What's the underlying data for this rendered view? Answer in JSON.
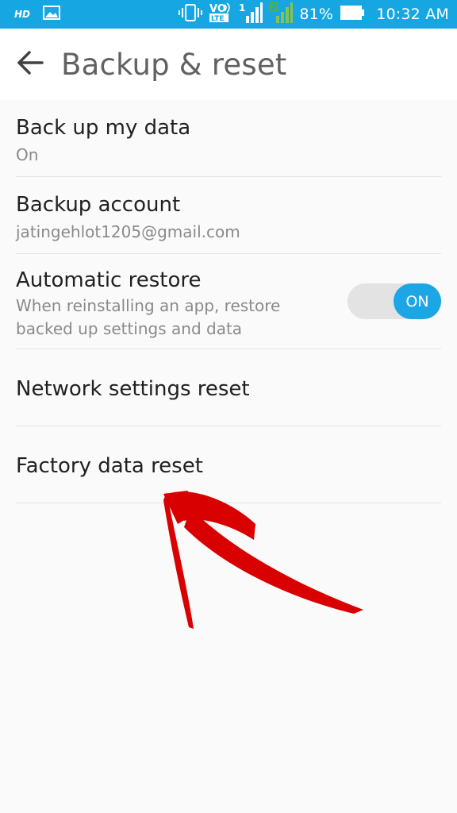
{
  "status_bar": {
    "hd_label": "HD",
    "volte_top": "VO",
    "volte_bottom": "LTE",
    "sim1_label": "1",
    "sim2_label": "2",
    "battery_percent": "81%",
    "time": "10:32 AM",
    "icons": [
      "hd-icon",
      "image-notification-icon",
      "vibrate-icon",
      "volte-icon",
      "signal-sim1-icon",
      "signal-sim2-icon",
      "battery-icon"
    ]
  },
  "header": {
    "title": "Backup & reset",
    "back_icon": "arrow-back-icon"
  },
  "settings": {
    "backup_data": {
      "title": "Back up my data",
      "subtitle": "On"
    },
    "backup_account": {
      "title": "Backup account",
      "subtitle": "jatingehlot1205@gmail.com"
    },
    "automatic_restore": {
      "title": "Automatic restore",
      "subtitle": "When reinstalling an app, restore backed up settings and data",
      "toggle_label": "ON",
      "toggle_state": "on"
    },
    "network_reset": {
      "title": "Network settings reset"
    },
    "factory_reset": {
      "title": "Factory data reset"
    }
  },
  "colors": {
    "status_bar": "#16a7e3",
    "accent": "#1ca6e6",
    "annotation_arrow": "#d80000"
  }
}
